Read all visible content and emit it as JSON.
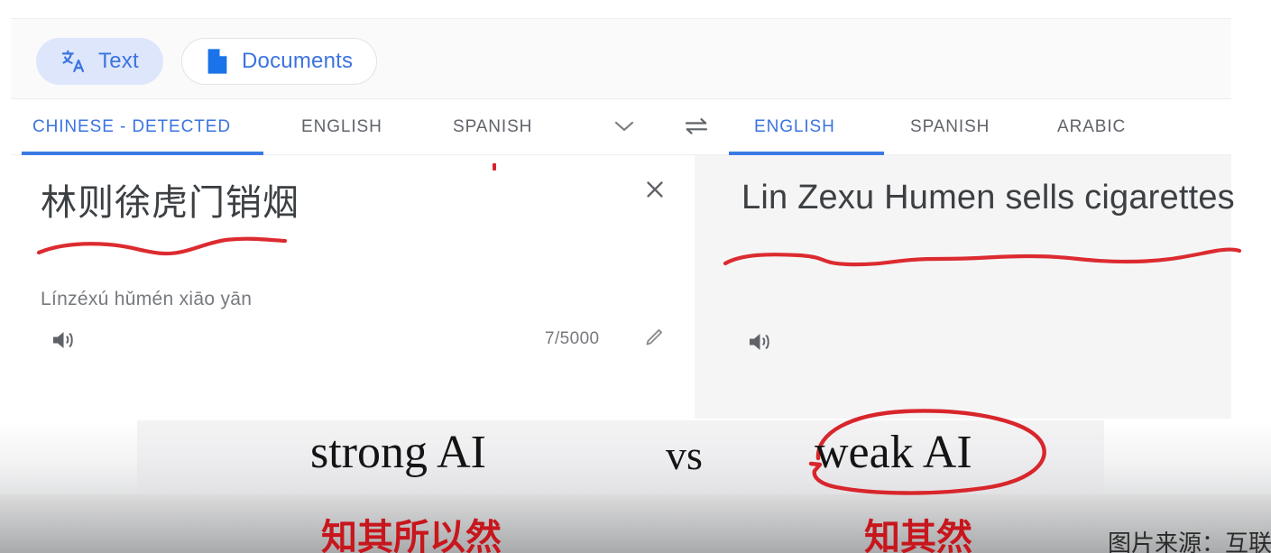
{
  "mode_bar": {
    "text_tab": {
      "label": "Text",
      "icon": "translate-icon",
      "active": true
    },
    "documents_tab": {
      "label": "Documents",
      "icon": "document-icon",
      "active": false
    }
  },
  "source_languages": {
    "tabs": [
      {
        "label": "CHINESE - DETECTED",
        "active": true
      },
      {
        "label": "ENGLISH",
        "active": false
      },
      {
        "label": "SPANISH",
        "active": false
      }
    ],
    "more_icon": "chevron-down-icon"
  },
  "swap_icon": "swap-languages-icon",
  "target_languages": {
    "tabs": [
      {
        "label": "ENGLISH",
        "active": true
      },
      {
        "label": "SPANISH",
        "active": false
      },
      {
        "label": "ARABIC",
        "active": false
      }
    ]
  },
  "source_pane": {
    "text": "林则徐虎门销烟",
    "pinyin": "Línzéxú hǔmén xiāo yān",
    "char_count": "7/5000",
    "clear_icon": "close-icon",
    "speaker_icon": "speaker-icon",
    "edit_icon": "pencil-icon"
  },
  "target_pane": {
    "text": "Lin Zexu Humen sells cigarettes",
    "speaker_icon": "speaker-icon"
  },
  "slide": {
    "strong": "strong AI",
    "vs": "vs",
    "weak": "weak AI",
    "cn_left": "知其所以然",
    "cn_right": "知其然",
    "credit": "图片来源：互联"
  },
  "colors": {
    "accent_blue": "#3b74e0",
    "underline_blue": "#3b7ae4",
    "chip_blue_bg": "#dde6fb",
    "annotation_red": "#dc2b30",
    "cn_red": "#c8161d",
    "target_pane_bg": "#f5f5f6",
    "text_primary": "#3c4043"
  }
}
